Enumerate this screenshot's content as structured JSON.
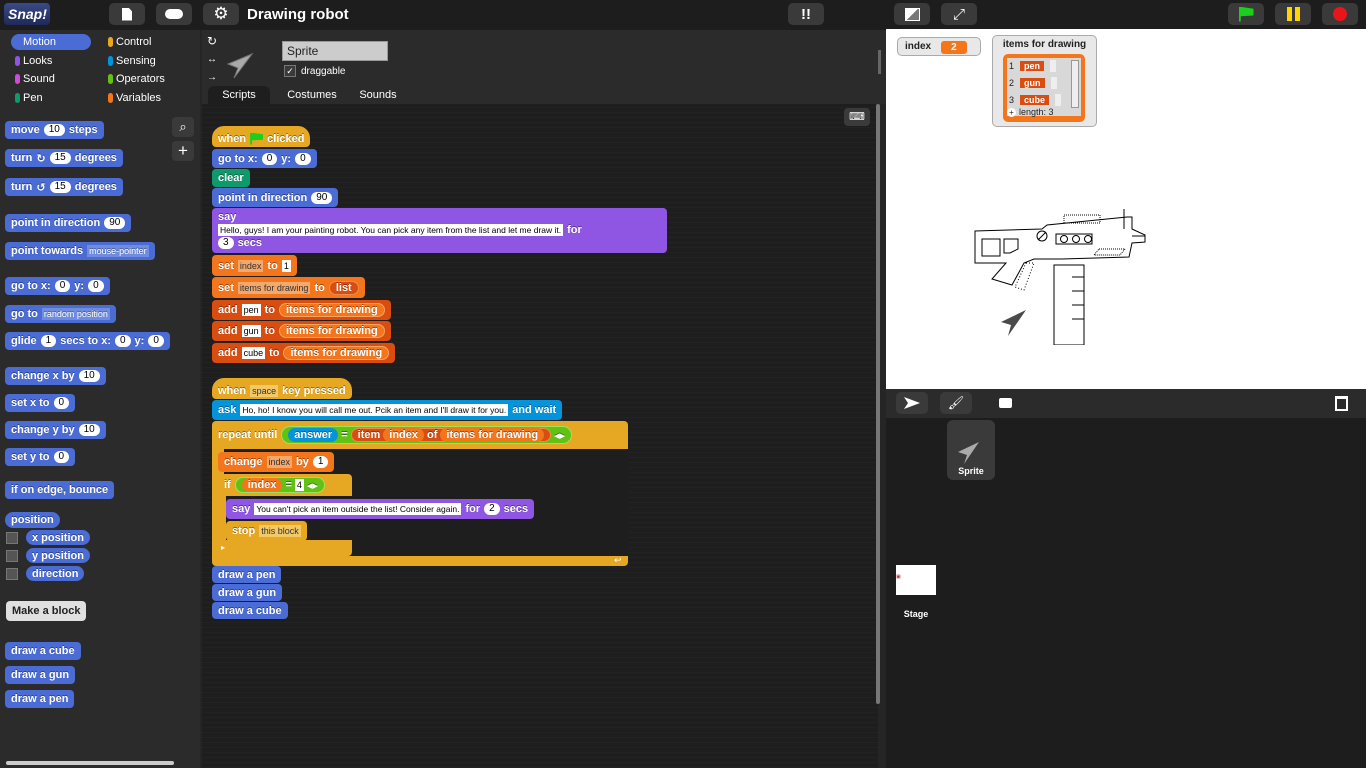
{
  "app": {
    "logo": "Snap!",
    "project_title": "Drawing robot"
  },
  "categories": [
    {
      "label": "Motion",
      "color": "#4a6cd4"
    },
    {
      "label": "Control",
      "color": "#e6a822"
    },
    {
      "label": "Looks",
      "color": "#8f56e3"
    },
    {
      "label": "Sensing",
      "color": "#0494dc"
    },
    {
      "label": "Sound",
      "color": "#cf4ad9"
    },
    {
      "label": "Operators",
      "color": "#62c213"
    },
    {
      "label": "Pen",
      "color": "#0e9a6c"
    },
    {
      "label": "Variables",
      "color": "#f3761d"
    }
  ],
  "sprite": {
    "name": "Sprite",
    "draggable_label": "draggable"
  },
  "tabs": [
    "Scripts",
    "Costumes",
    "Sounds"
  ],
  "palette": {
    "move": {
      "a": "move",
      "v": "10",
      "b": "steps"
    },
    "turn_cw": {
      "a": "turn",
      "v": "15",
      "b": "degrees"
    },
    "turn_ccw": {
      "a": "turn",
      "v": "15",
      "b": "degrees"
    },
    "point_dir": {
      "a": "point in direction",
      "v": "90"
    },
    "point_towards": {
      "a": "point towards",
      "v": "mouse-pointer"
    },
    "goto_xy": {
      "a": "go to x:",
      "x": "0",
      "b": "y:",
      "y": "0"
    },
    "goto": {
      "a": "go to",
      "v": "random position"
    },
    "glide": {
      "a": "glide",
      "s": "1",
      "b": "secs to x:",
      "x": "0",
      "c": "y:",
      "y": "0"
    },
    "change_x": {
      "a": "change x by",
      "v": "10"
    },
    "set_x": {
      "a": "set x to",
      "v": "0"
    },
    "change_y": {
      "a": "change y by",
      "v": "10"
    },
    "set_y": {
      "a": "set y to",
      "v": "0"
    },
    "bounce": "if on edge, bounce",
    "position": "position",
    "x_position": "x position",
    "y_position": "y position",
    "direction": "direction",
    "make_block": "Make a block",
    "custom": [
      "draw a cube",
      "draw a gun",
      "draw a pen"
    ]
  },
  "script1": {
    "hat_a": "when",
    "hat_b": "clicked",
    "goto_a": "go to x:",
    "goto_x": "0",
    "goto_b": "y:",
    "goto_y": "0",
    "clear": "clear",
    "point_a": "point in direction",
    "point_v": "90",
    "say_a": "say",
    "say_text": "Hello, guys! I am your painting robot. You can pick any item from the list and let me draw it.",
    "say_for": "for",
    "say_secs": "3",
    "say_b": "secs",
    "set1_a": "set",
    "set1_var": "index",
    "set1_to": "to",
    "set1_v": "1",
    "set2_a": "set",
    "set2_var": "items for drawing",
    "set2_to": "to",
    "set2_v": "list",
    "add1": {
      "a": "add",
      "v": "pen",
      "b": "to",
      "l": "items for drawing"
    },
    "add2": {
      "a": "add",
      "v": "gun",
      "b": "to",
      "l": "items for drawing"
    },
    "add3": {
      "a": "add",
      "v": "cube",
      "b": "to",
      "l": "items for drawing"
    }
  },
  "script2": {
    "hat_a": "when",
    "hat_key": "space",
    "hat_b": "key pressed",
    "ask_a": "ask",
    "ask_text": "Ho, ho! I know you will call me out. Pcik an item and I'll draw it for you.",
    "ask_b": "and wait",
    "repeat": "repeat until",
    "answer": "answer",
    "eq": "=",
    "item": "item",
    "index": "index",
    "of": "of",
    "list": "items for drawing",
    "change_a": "change",
    "change_var": "index",
    "change_by": "by",
    "change_v": "1",
    "if": "if",
    "if_var": "index",
    "if_eq": "=",
    "if_v": "4",
    "say2_a": "say",
    "say2_text": "You can't pick an item outside the list! Consider again.",
    "say2_for": "for",
    "say2_secs": "2",
    "say2_b": "secs",
    "stop_a": "stop",
    "stop_v": "this block",
    "draw": [
      "draw a pen",
      "draw a gun",
      "draw a cube"
    ]
  },
  "watchers": {
    "index_label": "index",
    "index_value": "2",
    "list_label": "items for drawing",
    "list_items": [
      {
        "i": "1",
        "v": "pen"
      },
      {
        "i": "2",
        "v": "gun"
      },
      {
        "i": "3",
        "v": "cube"
      }
    ],
    "length_label": "length: 3"
  },
  "corral": {
    "sprite": "Sprite",
    "stage": "Stage"
  }
}
